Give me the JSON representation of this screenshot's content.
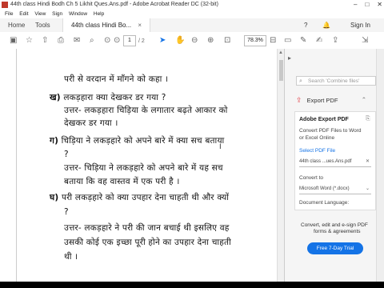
{
  "window": {
    "title": "44th class Hindi Bodh Ch 5 Likhit Ques.Ans.pdf - Adobe Acrobat Reader DC (32-bit)",
    "minimize": "–",
    "maximize": "□",
    "close": "✕"
  },
  "menu": [
    "File",
    "Edit",
    "View",
    "Sign",
    "Window",
    "Help"
  ],
  "tabs": {
    "home": "Home",
    "tools": "Tools",
    "doc": "44th class Hindi Bo...",
    "doc_close": "×",
    "help": "?",
    "signin": "Sign In"
  },
  "toolbar": {
    "page_current": "1",
    "page_total": "/ 2",
    "zoom": "78.3%"
  },
  "document": {
    "lines": [
      {
        "mark": "",
        "text": "परी से वरदान में माँगने को कहा ।"
      },
      {
        "mark": "ख)",
        "text": "लकड़हारा क्या देखकर डर गया ?"
      },
      {
        "mark": "",
        "text": "उत्तर- लकड़हारा चिड़िया के लगातार बढ़ते आकार को"
      },
      {
        "mark": "",
        "text": "देखकर डर गया ।"
      },
      {
        "mark": "ग)",
        "text": "चिड़िया ने लकड़हारे को अपने बारे में क्या सच बताया"
      },
      {
        "mark": "",
        "text": "?"
      },
      {
        "mark": "",
        "text": "उत्तर- चिड़िया ने लकड़हारे को अपने बारे में यह सच"
      },
      {
        "mark": "",
        "text": "बताया कि वह वास्तव में एक परी है ।"
      },
      {
        "mark": "घ)",
        "text": "परी लकड़हारे को क्या उपहार देना चाहती थी और क्यों"
      },
      {
        "mark": "",
        "text": "?"
      },
      {
        "mark": "",
        "text": "उत्तर- लकड़हारे ने परी की जान बचाई थी इसलिए वह"
      },
      {
        "mark": "",
        "text": "उसकी कोई एक इच्छा पूरी होने का उपहार देना चाहती"
      },
      {
        "mark": "",
        "text": "थी ।"
      }
    ]
  },
  "panel": {
    "search_placeholder": "Search 'Combine files'",
    "export_title": "Export PDF",
    "card_title": "Adobe Export PDF",
    "card_desc_1": "Convert PDF Files to Word",
    "card_desc_2": "or Excel Online",
    "select_file": "Select PDF File",
    "file_name": "44th class ...ues.Ans.pdf",
    "convert_to": "Convert to",
    "convert_value": "Microsoft Word (*.docx)",
    "doc_language": "Document Language:",
    "promo_1": "Convert, edit and e-sign PDF",
    "promo_2": "forms & agreements",
    "trial_button": "Free 7-Day Trial"
  },
  "colors": {
    "accent": "#1473e6",
    "export_icon": "#e34850"
  }
}
